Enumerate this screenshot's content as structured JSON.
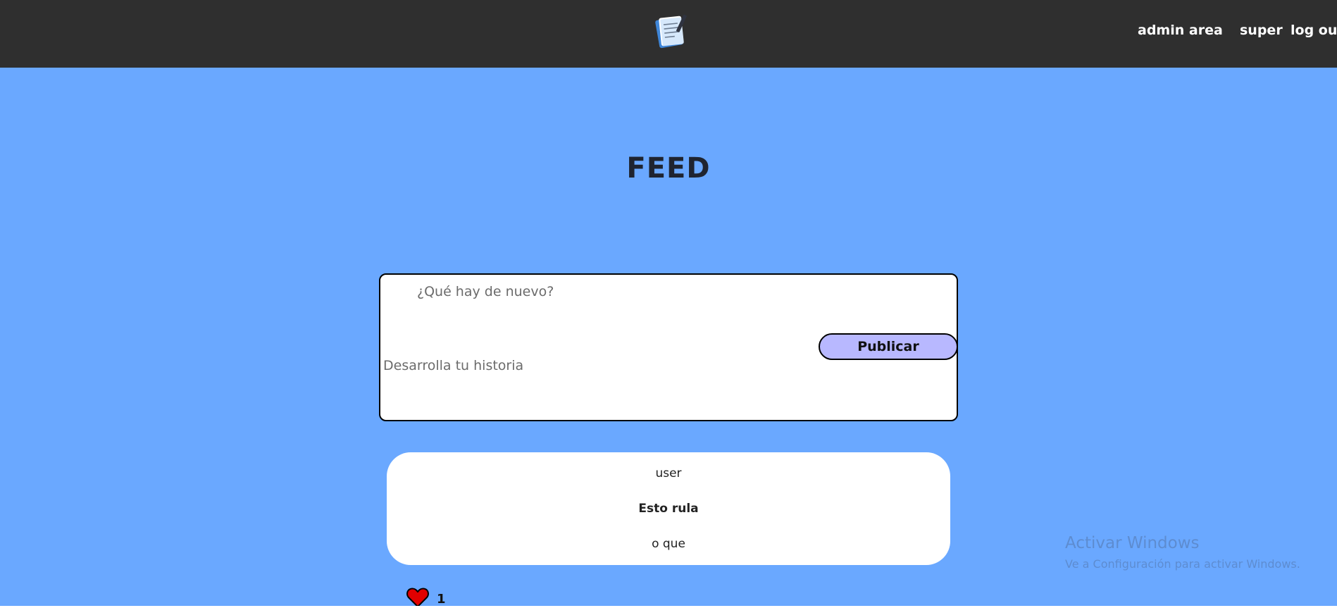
{
  "navbar": {
    "logo_icon": "notepad-pencil-icon",
    "links": {
      "admin": "admin area",
      "user": "super",
      "logout": "log out"
    },
    "background": "#2f2f2f"
  },
  "main": {
    "background": "#6aa8ff",
    "title": "FEED"
  },
  "composer": {
    "title_placeholder": "¿Qué hay de nuevo?",
    "body_placeholder": "Desarrolla tu historia",
    "publish_label": "Publicar",
    "publish_color": "#b8b8ff"
  },
  "posts": [
    {
      "author": "user",
      "title": "Esto rula",
      "body": "o que",
      "likes": "1",
      "like_icon": "heart-icon",
      "like_color": "#e10000"
    }
  ],
  "watermark": {
    "title": "Activar Windows",
    "subtitle": "Ve a Configuración para activar Windows."
  }
}
